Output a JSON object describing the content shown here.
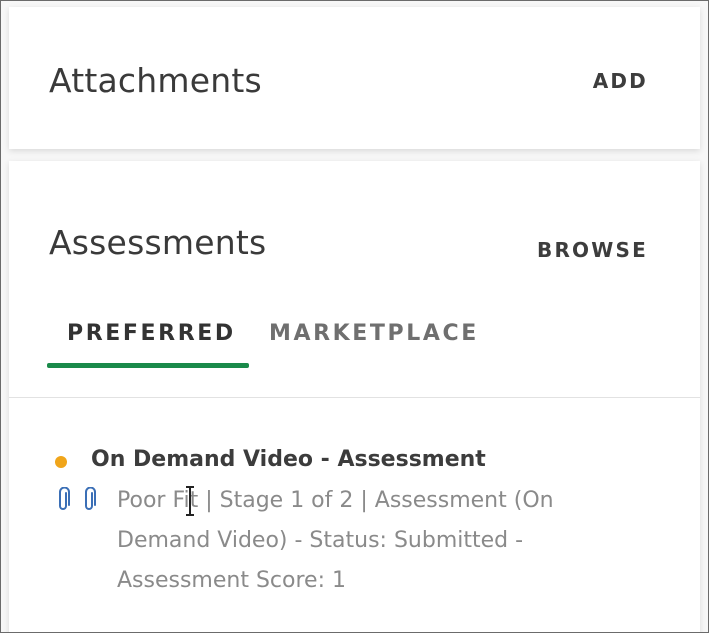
{
  "attachments": {
    "title": "Attachments",
    "action_label": "ADD"
  },
  "assessments": {
    "title": "Assessments",
    "action_label": "BROWSE",
    "tabs": [
      {
        "label": "PREFERRED",
        "active": true
      },
      {
        "label": "MARKETPLACE",
        "active": false
      }
    ],
    "items": [
      {
        "title": "On Demand Video - Assessment",
        "status_color": "#f0a51a",
        "icons": [
          "paperclip-icon",
          "paperclip-icon"
        ],
        "description": "Poor Fit | Stage 1 of 2 | Assessment (On Demand Video) - Status: Submitted - Assessment Score: 1"
      }
    ]
  },
  "colors": {
    "accent_green": "#1a8a4a",
    "clip_blue": "#3b6fb6",
    "status_orange": "#f0a51a"
  }
}
